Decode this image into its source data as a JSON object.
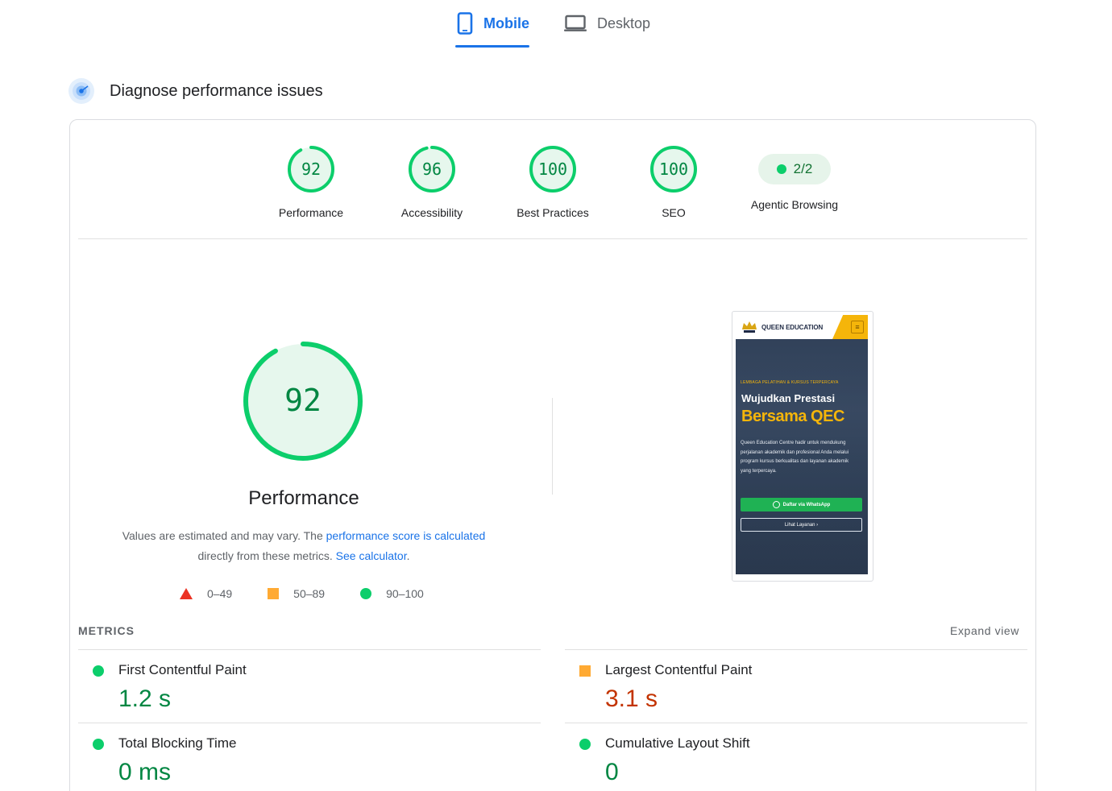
{
  "tabs": {
    "mobile_label": "Mobile",
    "desktop_label": "Desktop",
    "active": "Mobile"
  },
  "section": {
    "title": "Diagnose performance issues"
  },
  "categories": [
    {
      "label": "Performance",
      "score": 92
    },
    {
      "label": "Accessibility",
      "score": 96
    },
    {
      "label": "Best Practices",
      "score": 100
    },
    {
      "label": "SEO",
      "score": 100
    }
  ],
  "agentic": {
    "count": "2/2",
    "label": "Agentic Browsing"
  },
  "performance": {
    "score": 92,
    "score_text": "92",
    "title": "Performance",
    "note_part1": "Values are estimated and may vary. The ",
    "note_link1": "performance score is calculated",
    "note_part2": " directly from these metrics. ",
    "note_link2": "See calculator",
    "note_end": "."
  },
  "legend": {
    "fail": "0–49",
    "average": "50–89",
    "pass": "90–100"
  },
  "screenshot": {
    "brand": "QUEEN EDUCATION",
    "menu_glyph": "≡",
    "tagline": "LEMBAGA PELATIHAN & KURSUS TERPERCAYA",
    "headline": "Wujudkan Prestasi",
    "headline_accent": "Bersama QEC",
    "description": "Queen Education Centre hadir untuk mendukung perjalanan akademik dan profesional Anda melalui program kursus berkualitas dan layanan akademik yang terpercaya.",
    "cta_primary": "Daftar via WhatsApp",
    "cta_secondary": "Lihat Layanan  ›"
  },
  "metrics": {
    "heading": "METRICS",
    "expand_label": "Expand view",
    "items": [
      {
        "name": "First Contentful Paint",
        "value": "1.2 s",
        "rating": "pass"
      },
      {
        "name": "Largest Contentful Paint",
        "value": "3.1 s",
        "rating": "average"
      },
      {
        "name": "Total Blocking Time",
        "value": "0 ms",
        "rating": "pass"
      },
      {
        "name": "Cumulative Layout Shift",
        "value": "0",
        "rating": "pass"
      }
    ]
  },
  "colors": {
    "accent": "#1a73e8",
    "pass": "#0cce6b",
    "pass_text": "#018642",
    "average": "#ffaa33",
    "average_text": "#c33300",
    "fail": "#eb3223",
    "gauge_fill": "#e6f7ed"
  }
}
